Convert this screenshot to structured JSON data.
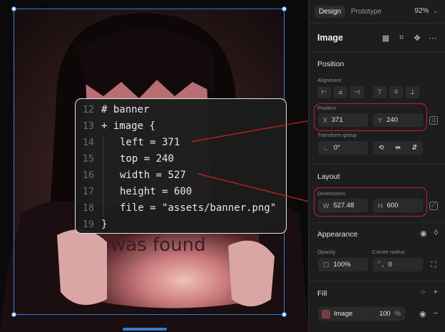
{
  "panel": {
    "tabs": [
      "Design",
      "Prototype"
    ],
    "zoom": "92%",
    "layer_name": "Image",
    "position_section": {
      "title": "Position",
      "alignment_label": "Alignment",
      "position_label": "Position",
      "x_prefix": "X",
      "x_value": "371",
      "y_prefix": "Y",
      "y_value": "240",
      "transform_group_label": "Transform group",
      "rotation_value": "0°"
    },
    "layout_section": {
      "title": "Layout",
      "dimensions_label": "Dimensions",
      "w_prefix": "W",
      "w_value": "527.48",
      "h_prefix": "H",
      "h_value": "600"
    },
    "appearance_section": {
      "title": "Appearance",
      "opacity_label": "Opacity",
      "opacity_value": "100%",
      "corner_radius_label": "Corner radius",
      "corner_radius_value": "0"
    },
    "fill_section": {
      "title": "Fill",
      "fill_name": "Image",
      "fill_opacity": "100",
      "fill_percent": "%"
    }
  },
  "code": {
    "lines": [
      {
        "num": "12",
        "text": "# banner"
      },
      {
        "num": "13",
        "text": "+ image {"
      },
      {
        "num": "14",
        "text": "left = 371"
      },
      {
        "num": "15",
        "text": "top = 240"
      },
      {
        "num": "16",
        "text": "width = 527"
      },
      {
        "num": "17",
        "text": "height = 600"
      },
      {
        "num": "18",
        "text": "file = \"assets/banner.png\""
      },
      {
        "num": "19",
        "text": "}"
      }
    ]
  },
  "canvas": {
    "sign_text": "was found"
  },
  "colors": {
    "selection": "#2f7fd6",
    "highlight": "#c81f25",
    "panel_bg": "#1d1d1f"
  }
}
